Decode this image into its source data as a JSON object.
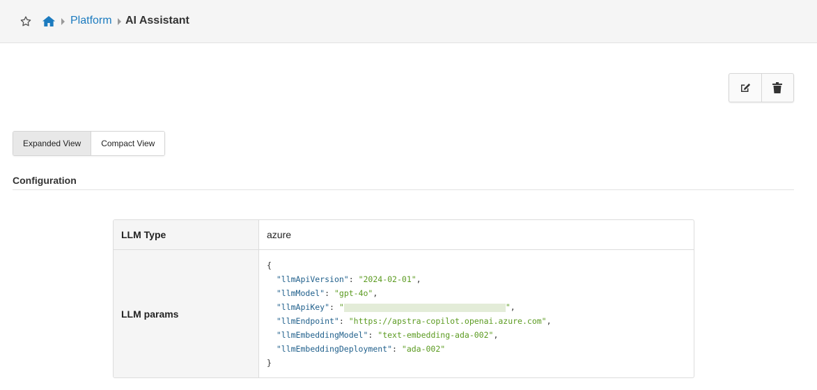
{
  "breadcrumb": {
    "parent": "Platform",
    "current": "AI Assistant"
  },
  "view_toggle": {
    "expanded_label": "Expanded View",
    "compact_label": "Compact View",
    "active": "expanded"
  },
  "section": {
    "title": "Configuration"
  },
  "config": {
    "llm_type_label": "LLM Type",
    "llm_type_value": "azure",
    "llm_params_label": "LLM params",
    "params": {
      "open": "{",
      "close": "}",
      "llmApiVersion_key": "\"llmApiVersion\"",
      "llmApiVersion_value": "\"2024-02-01\"",
      "llmModel_key": "\"llmModel\"",
      "llmModel_value": "\"gpt-4o\"",
      "llmApiKey_key": "\"llmApiKey\"",
      "llmEndpoint_key": "\"llmEndpoint\"",
      "llmEndpoint_value": "\"https://apstra-copilot.openai.azure.com\"",
      "llmEmbeddingModel_key": "\"llmEmbeddingModel\"",
      "llmEmbeddingModel_value": "\"text-embedding-ada-002\"",
      "llmEmbeddingDeployment_key": "\"llmEmbeddingDeployment\"",
      "llmEmbeddingDeployment_value": "\"ada-002\""
    }
  },
  "colors": {
    "link": "#1c7bbf",
    "json_key": "#1f5f8b",
    "json_value": "#5a9a1f"
  },
  "icons": [
    "star-icon",
    "home-icon",
    "edit-icon",
    "trash-icon"
  ]
}
